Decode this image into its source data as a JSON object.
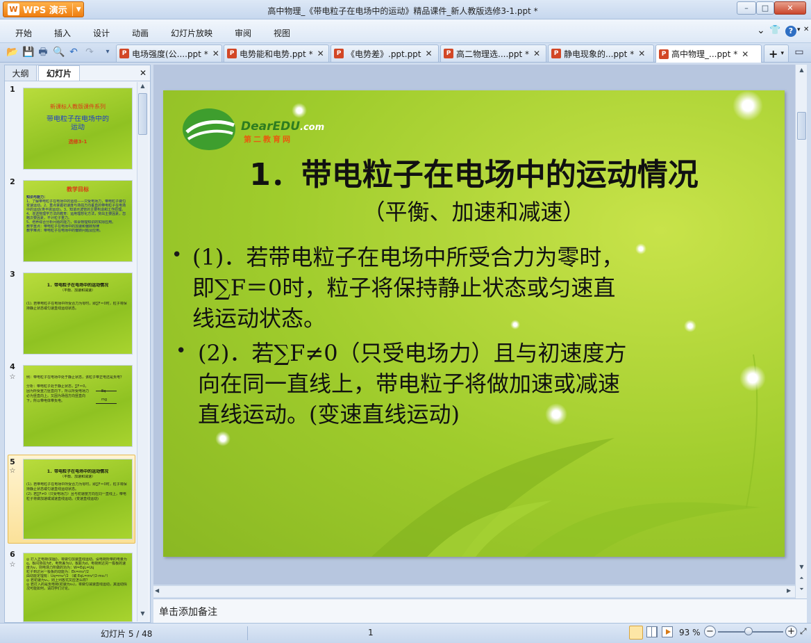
{
  "app": {
    "name": "WPS 演示",
    "logo_glyph": "W"
  },
  "window": {
    "title": "高中物理_《带电粒子在电场中的运动》精品课件_新人教版选修3-1.ppt *",
    "min": "–",
    "max": "□",
    "close": "✕"
  },
  "menu": [
    "开始",
    "插入",
    "设计",
    "动画",
    "幻灯片放映",
    "审阅",
    "视图"
  ],
  "menu_right": {
    "chevron": "⌄",
    "shirt": "👕",
    "help": "?",
    "help_arrow": "▾",
    "close": "✕"
  },
  "toolbar_icons": [
    "📂",
    "💾",
    "🖶",
    "🔍",
    "↶",
    "↷",
    "▾"
  ],
  "doc_tabs": [
    {
      "label": "电场强度(公....ppt *",
      "close": "✕",
      "active": false
    },
    {
      "label": "电势能和电势.ppt *",
      "close": "✕",
      "active": false
    },
    {
      "label": "《电势差》.ppt.ppt",
      "close": "✕",
      "active": false
    },
    {
      "label": "高二物理选....ppt *",
      "close": "✕",
      "active": false
    },
    {
      "label": "静电现象的...ppt *",
      "close": "✕",
      "active": false
    },
    {
      "label": "高中物理_...ppt *",
      "close": "✕",
      "active": true
    }
  ],
  "tab_add": "+",
  "tab_more": "▾",
  "tab_restore": "▭",
  "panel": {
    "tab_outline": "大纲",
    "tab_slides": "幻灯片",
    "close": "✕"
  },
  "thumbnails": [
    {
      "num": "1",
      "star": "",
      "lines": [
        "新课标人教版课件系列",
        "带电粒子在电场中的",
        "运动",
        "选修3-1"
      ]
    },
    {
      "num": "2",
      "star": "",
      "lines": [
        "教学目标",
        "知识与能力：",
        "1、了解带电粒子在电场中的运动——只受电场力，带电粒子做匀变速运动。2、重点掌握初速度与场强方向垂直的带电粒子在电场中的运动(类平抛运动)。3、知道示波管的主要构造和工作原理。4、渗透物理学方法的教育：运用理想化方法，突出主要因素，忽略次要因素，不计粒子重力。",
        "5、培养综合分析问题的能力，体会物理知识的实际应用。",
        "教学重点：带电粒子在电场中的加速和偏转规律",
        "教学难点：带电粒子在电场中的偏转问题及应用。"
      ]
    },
    {
      "num": "3",
      "star": "",
      "lines": [
        "1．带电粒子在电场中的运动情况",
        "（平衡、加速和减速）",
        "(1). 若带电粒子在电场中所受合力为零时，即∑F＝0时，粒子将保持静止状态或匀速直线运动状态。"
      ]
    },
    {
      "num": "4",
      "star": "☆",
      "lines": [
        "例：带电粒子在电场中处于静止状态，该粒子带正电还是负电？",
        "分析：带电粒子处于静止状态，∑F＝0，",
        "因为所受重力竖直向下，所以所受电场力必为竖直向上。又因为场强方向竖直向下，所以带电体带负电。",
        "Eq",
        "mg"
      ]
    },
    {
      "num": "5",
      "star": "☆",
      "lines": [
        "1．带电粒子在电场中的运动情况",
        "（平衡、加速和减速）",
        "(1). 若带电粒子在电场中所受合力为零时，即∑F＝0时，粒子将保持静止状态或匀速直线运动状态。",
        "(2). 若∑F≠0（只受电场力）且与初速度方向在同一直线上，带电粒子将做加速或减速直线运动。(变速直线运动)"
      ]
    },
    {
      "num": "6",
      "star": "☆",
      "lines": [
        "◎ 打入正电荷(如图)，将做匀加速直线运动。设电荷所带的电量为q，板间场强为E，电势差为U，板距为d，电荷到达另一极板的速度为v，则电场力所做的功为：W=EqL=Uq",
        "粒子到达另一极板的动能为：Ek=mv²/2",
        "由动能定理有：Uq=mv²/2 （或 EqL=mv²/2-mv₀²）",
        "◎ 若初速为v₀，则上列各式又应怎么样？",
        "◎ 若打入的是负电荷(初速为v₀)，将做匀减速直线运动，其运动情况可能如何，请同学们讨论。"
      ]
    }
  ],
  "slide": {
    "logo_text": "DearEDU",
    "logo_suffix": ".com",
    "logo_cn": "第二教育网",
    "title": "1．带电粒子在电场中的运动情况",
    "subtitle": "（平衡、加速和减速）",
    "bullets": [
      [
        "(1)．若带电粒子在电场中所受合力为零时，",
        "即∑F＝0时，粒子将保持静止状态或匀速直",
        "线运动状态。"
      ],
      [
        "(2)．若∑F≠0（只受电场力）且与初速度方",
        "向在同一直线上，带电粒子将做加速或减速",
        "直线运动。(变速直线运动)"
      ]
    ],
    "bullet_glyph": "•"
  },
  "notes_placeholder": "单击添加备注",
  "status": {
    "slide_counter": "幻灯片 5 / 48",
    "section": "1",
    "zoom": "93 %",
    "zoom_minus": "−",
    "zoom_plus": "+",
    "zoom_level": 0.93
  },
  "colors": {
    "accent_orange": "#ee7d10",
    "slide_green": "#9fcc2c",
    "thumb_title_red": "#d83a16",
    "thumb_text_blue": "#1b1b8a"
  }
}
